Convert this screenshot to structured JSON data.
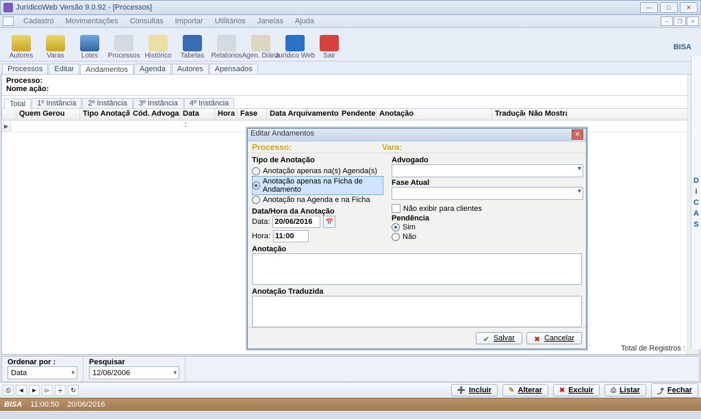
{
  "window": {
    "title": "JurídicoWeb Versão 9.0.92 - [Processos]"
  },
  "menu": [
    "Cadastro",
    "Movimentações",
    "Consultas",
    "Importar",
    "Utilitários",
    "Janelas",
    "Ajuda"
  ],
  "toolbar": [
    {
      "label": "Autores",
      "cls": "g-autores"
    },
    {
      "label": "Varas",
      "cls": "g-varas"
    },
    {
      "label": "Lotes",
      "cls": "g-lotes"
    },
    {
      "label": "Processos",
      "cls": "g-proc"
    },
    {
      "label": "Histórico",
      "cls": "g-hist"
    },
    {
      "label": "Tabelas",
      "cls": "g-tab"
    },
    {
      "label": "Relatorios",
      "cls": "g-rel"
    },
    {
      "label": "Agen. Diária",
      "cls": "g-agen"
    },
    {
      "label": "Jurídico Web",
      "cls": "g-jw"
    },
    {
      "label": "Sair",
      "cls": "g-sair"
    }
  ],
  "brand": "BISA",
  "tabs_main": [
    "Processos",
    "Editar",
    "Andamentos",
    "Agenda",
    "Autores",
    "Apensados"
  ],
  "tabs_main_active": 2,
  "proc": {
    "l1": "Processo:",
    "l2": "Nome ação:"
  },
  "tabs_inst": [
    "Total",
    "1º Instância",
    "2º Instância",
    "3º Instância",
    "4º Instância"
  ],
  "tabs_inst_active": 0,
  "grid_cols": [
    "Quem Gerou",
    "Tipo Anotação",
    "Cód. Advogado",
    "Data",
    "Hora",
    "Fase",
    "Data Arquivamento",
    "Pendente",
    "Anotação",
    "Tradução",
    "Não Mostra"
  ],
  "grid_cell_hora": ":",
  "footer_reg": "Total de Registros :",
  "dialog": {
    "title": "Editar Andamentos",
    "processo_lbl": "Processo:",
    "vara_lbl": "Vara:",
    "tipo_grp": "Tipo de Anotação",
    "radios": [
      "Anotação apenas na(s) Agenda(s)",
      "Anotação apenas na Ficha de Andamento",
      "Anotação na Agenda e na Ficha"
    ],
    "radios_selected": 1,
    "dh_lbl": "Data/Hora da Anotação",
    "data_lbl": "Data:",
    "data_val": "20/06/2016",
    "hora_lbl": "Hora:",
    "hora_val": "11:00",
    "advogado_lbl": "Advogado",
    "fase_lbl": "Fase Atual",
    "naoexibir": "Não exibir para clientes",
    "pend_lbl": "Pendência",
    "pend_sim": "Sim",
    "pend_nao": "Não",
    "anot_lbl": "Anotação",
    "trad_lbl": "Anotação Traduzida",
    "salvar": "Salvar",
    "cancelar": "Cancelar"
  },
  "bottom": {
    "ordenar_lbl": "Ordenar por :",
    "ordenar_val": "Data",
    "pesq_lbl": "Pesquisar",
    "pesq_val": "12/06/2006"
  },
  "actions": {
    "incluir": "Incluir",
    "alterar": "Alterar",
    "excluir": "Excluir",
    "listar": "Listar",
    "fechar": "Fechar"
  },
  "status": {
    "logo": "BISA",
    "time": "11:00:50",
    "date": "20/06/2016"
  },
  "dicas": [
    "D",
    "I",
    "C",
    "A",
    "S"
  ]
}
